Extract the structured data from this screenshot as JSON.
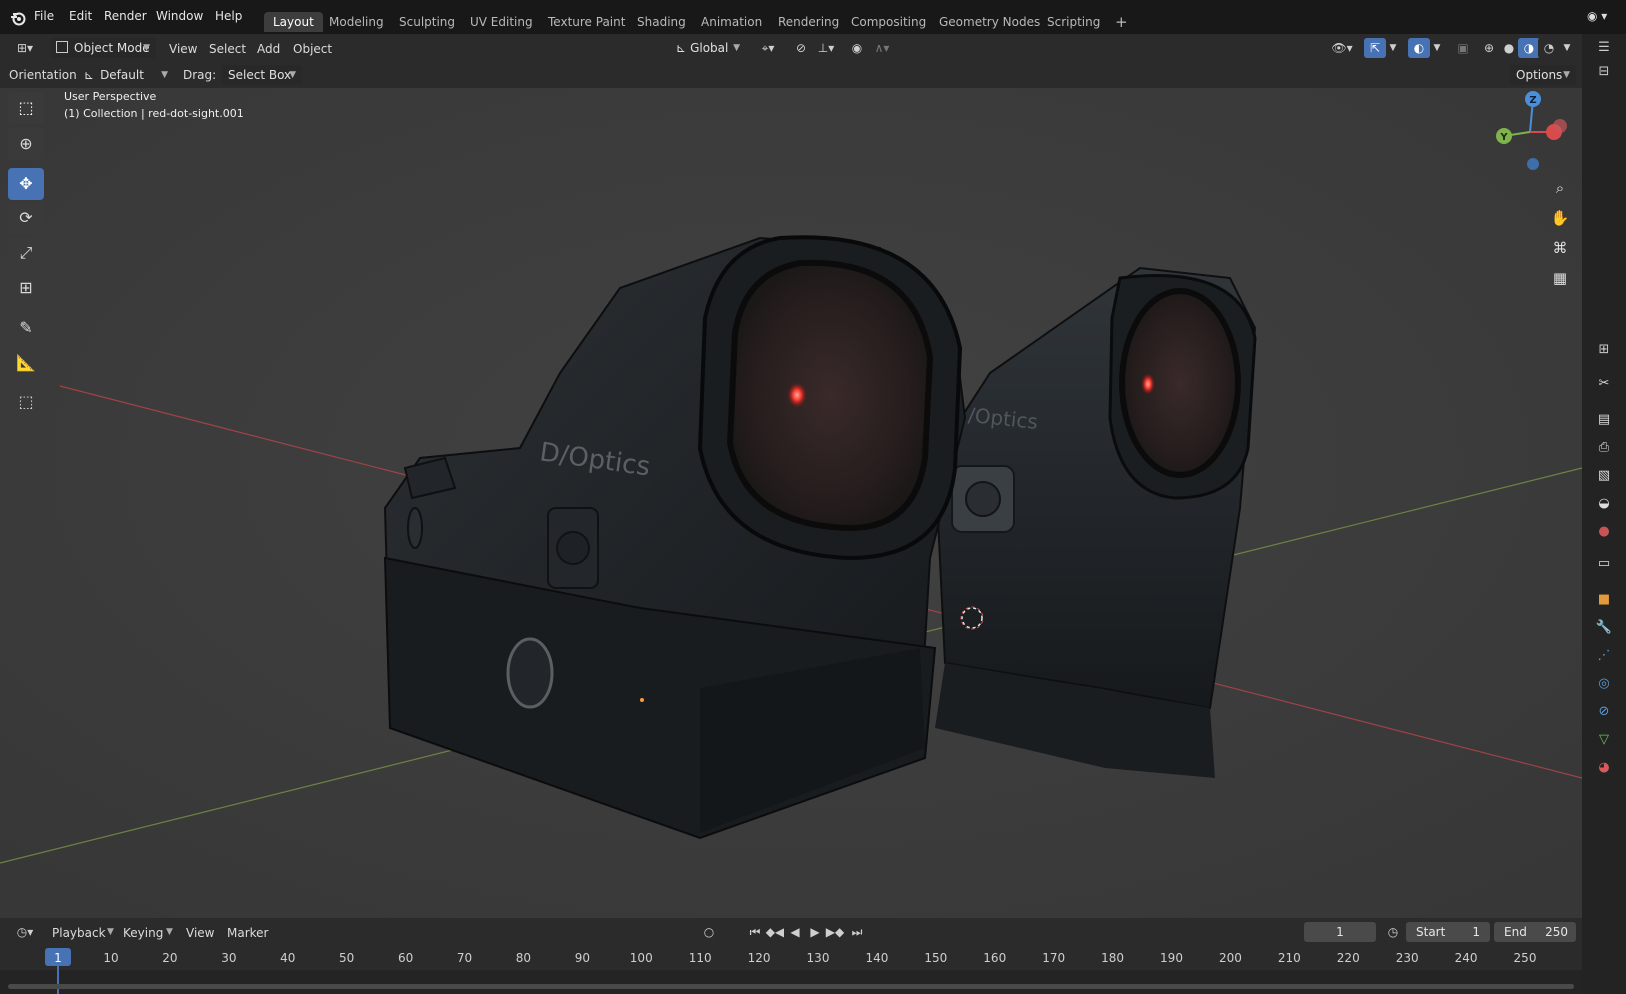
{
  "topbar": {
    "menus": [
      "File",
      "Edit",
      "Render",
      "Window",
      "Help"
    ],
    "workspaces": [
      "Layout",
      "Modeling",
      "Sculpting",
      "UV Editing",
      "Texture Paint",
      "Shading",
      "Animation",
      "Rendering",
      "Compositing",
      "Geometry Nodes",
      "Scripting"
    ],
    "add_tab": "+"
  },
  "header": {
    "mode": "Object Mode",
    "menus": [
      "View",
      "Select",
      "Add",
      "Object"
    ],
    "transform_orientation": "Global",
    "orientation_label": "Orientation:",
    "orientation_value": "Default",
    "drag_label": "Drag:",
    "drag_value": "Select Box",
    "options_label": "Options"
  },
  "viewport": {
    "overlay_line1": "User Perspective",
    "overlay_line2": "(1) Collection | red-dot-sight.001",
    "gizmo": {
      "x": "X",
      "y": "Y",
      "z": "Z"
    },
    "brand_text": "D/Optics",
    "brand_text_2": "/Optics"
  },
  "timeline": {
    "menus": [
      "Playback",
      "Keying",
      "View",
      "Marker"
    ],
    "current_frame": "1",
    "start_label": "Start",
    "start_value": "1",
    "end_label": "End",
    "end_value": "250",
    "frame_labels": [
      "1",
      "10",
      "20",
      "30",
      "40",
      "50",
      "60",
      "70",
      "80",
      "90",
      "100",
      "110",
      "120",
      "130",
      "140",
      "150",
      "160",
      "170",
      "180",
      "190",
      "200",
      "210",
      "220",
      "230",
      "240",
      "250"
    ]
  },
  "colors": {
    "accent": "#4772b3",
    "axis_x": "#d94a4a",
    "axis_y": "#7fb34d",
    "axis_z": "#4a8fd9",
    "red_dot": "#ff3b2f"
  },
  "icons": [
    "blender-logo-icon",
    "editor-type-icon",
    "object-mode-icon",
    "select-box-tool-icon",
    "cursor-tool-icon",
    "move-tool-icon",
    "rotate-tool-icon",
    "scale-tool-icon",
    "transform-tool-icon",
    "annotate-tool-icon",
    "measure-tool-icon",
    "add-cube-tool-icon",
    "zoom-icon",
    "pan-hand-icon",
    "camera-view-icon",
    "grid-projection-icon",
    "play-icon",
    "jump-start-icon",
    "jump-end-icon",
    "clock-icon"
  ]
}
